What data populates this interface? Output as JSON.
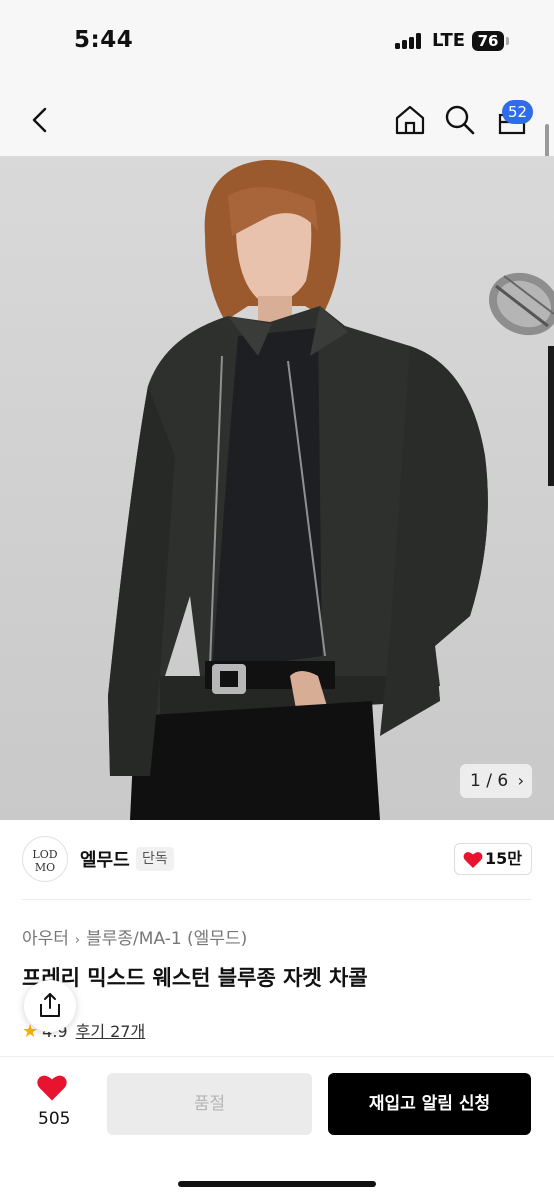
{
  "status_bar": {
    "time": "5:44",
    "network": "LTE",
    "battery": "76"
  },
  "nav": {
    "back_icon": "chevron-left-icon",
    "home_icon": "home-icon",
    "search_icon": "search-icon",
    "cart_icon": "bag-icon",
    "cart_count": "52"
  },
  "gallery": {
    "pager": "1 / 6"
  },
  "brand": {
    "logo_text_1": "LOD",
    "logo_text_2": "MO",
    "name": "엘무드",
    "tag": "단독",
    "likes": "15만"
  },
  "product": {
    "breadcrumb": [
      "아우터",
      "블루종/MA-1 (엘무드)"
    ],
    "title": "프레리 믹스드 웨스턴 블루종 자켓 차콜",
    "rating": "4.9",
    "reviews": "후기 27개"
  },
  "bottom": {
    "wish_count": "505",
    "soldout_label": "품절",
    "restock_label": "재입고 알림 신청"
  },
  "colors": {
    "accent_badge": "#2f6de8",
    "heart": "#e8132f",
    "primary_button": "#000000",
    "disabled_button": "#ebebeb"
  }
}
